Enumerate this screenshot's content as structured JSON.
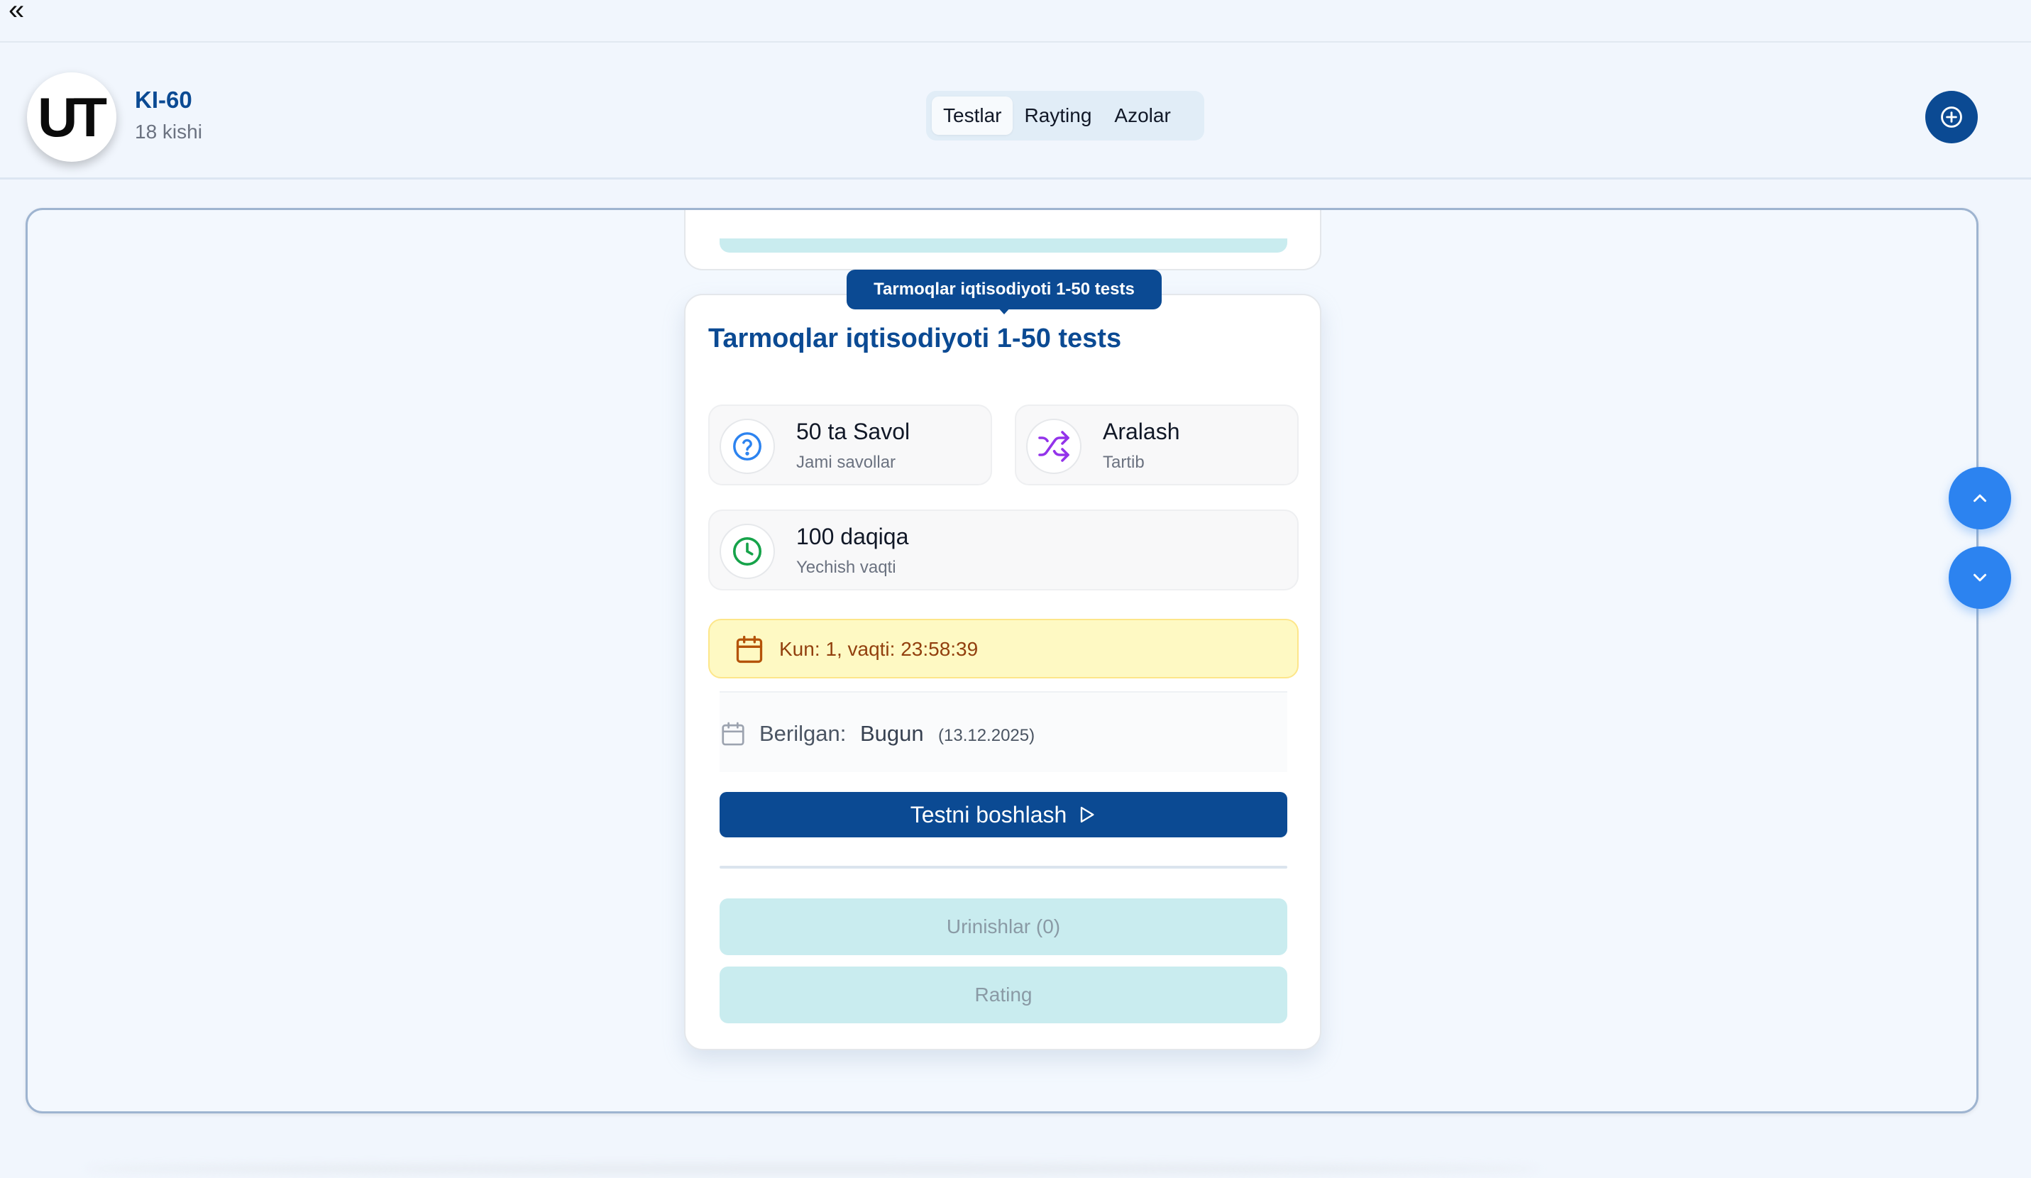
{
  "nav": {
    "collapse_label": "«"
  },
  "header": {
    "logo_text": "UT",
    "group_name": "KI-60",
    "group_members": "18 kishi",
    "tabs": [
      {
        "label": "Testlar",
        "active": true
      },
      {
        "label": "Rayting",
        "active": false
      },
      {
        "label": "Azolar",
        "active": false
      }
    ],
    "add_icon": "plus-circle-icon"
  },
  "test": {
    "tooltip": "Tarmoqlar iqtisodiyoti 1-50 tests",
    "title": "Tarmoqlar iqtisodiyoti 1-50 tests",
    "questions": {
      "value": "50 ta Savol",
      "label": "Jami savollar",
      "icon": "question-circle-icon"
    },
    "order": {
      "value": "Aralash",
      "label": "Tartib",
      "icon": "shuffle-icon"
    },
    "time": {
      "value": "100 daqiqa",
      "label": "Yechish vaqti",
      "icon": "clock-icon"
    },
    "deadline": "Kun: 1, vaqti: 23:58:39",
    "given_label": "Berilgan:",
    "given_value": "Bugun",
    "given_date": "(13.12.2025)",
    "start_button": "Testni boshlash",
    "attempts_button": "Urinishlar (0)",
    "rating_button": "Rating"
  },
  "colors": {
    "primary": "#0b4a93",
    "accent_blue": "#2c83f0",
    "deadline_bg": "#fef9c3",
    "deadline_text": "#92400e",
    "secondary_btn": "#c9ecef",
    "shuffle_purple": "#9333ea",
    "clock_green": "#16a34a"
  }
}
